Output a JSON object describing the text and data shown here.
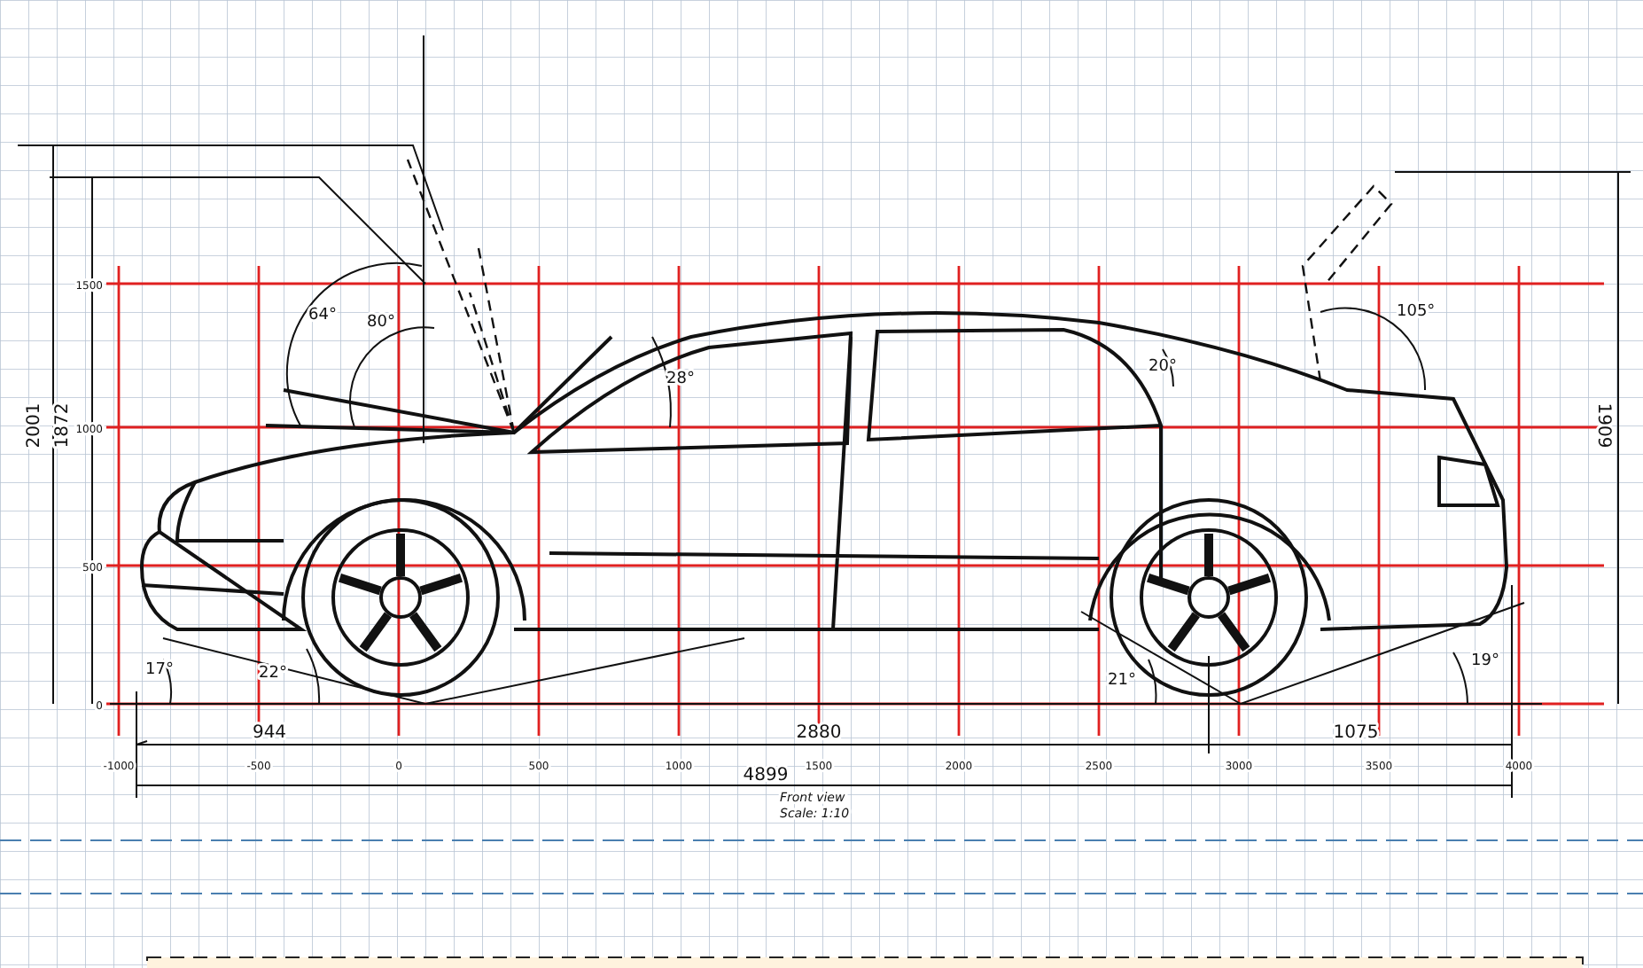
{
  "drawing": {
    "angle_labels": [
      "64°",
      "80°",
      "28°",
      "20°",
      "105°",
      "17°",
      "22°",
      "21°",
      "19°"
    ],
    "height_dims": [
      "2001",
      "1872",
      "1909"
    ],
    "length_dims": [
      "944",
      "2880",
      "1075"
    ],
    "overall_length": "4899",
    "x_ticks": [
      "-1000",
      "-500",
      "0",
      "500",
      "1000",
      "1500",
      "2000",
      "2500",
      "3000",
      "3500",
      "4000"
    ],
    "y_ticks": [
      "1500",
      "1000",
      "500",
      "0"
    ],
    "view_label": "Front view",
    "scale_label": "Scale: 1:10"
  }
}
